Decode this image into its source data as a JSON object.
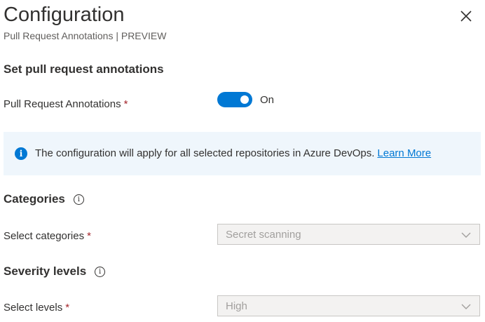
{
  "header": {
    "title": "Configuration",
    "subtitle": "Pull Request Annotations | PREVIEW"
  },
  "section": {
    "heading": "Set pull request annotations"
  },
  "pr_annotations": {
    "label": "Pull Request Annotations",
    "required_mark": "*",
    "toggle_state": "On",
    "enabled": true
  },
  "info": {
    "icon": "info-icon",
    "text": "The configuration will apply for all selected repositories in Azure DevOps.",
    "link": "Learn More"
  },
  "categories": {
    "heading": "Categories",
    "help_icon": "i",
    "label": "Select categories",
    "required_mark": "*",
    "value": "Secret scanning"
  },
  "severity": {
    "heading": "Severity levels",
    "help_icon": "i",
    "label": "Select levels",
    "required_mark": "*",
    "value": "High"
  },
  "colors": {
    "accent": "#0078d4",
    "info_background": "#eff6fc",
    "required": "#a4262c",
    "disabled_field": "#f3f2f1"
  }
}
